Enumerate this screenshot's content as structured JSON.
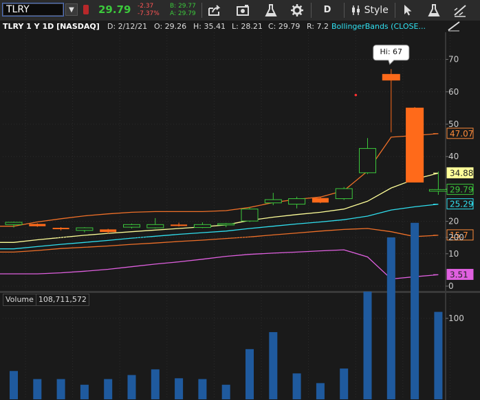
{
  "toolbar": {
    "symbol": "TLRY",
    "last_price": "29.79",
    "net_change": "-2.37",
    "pct_change": "-7.37%",
    "bid": "B: 29.77",
    "ask": "A: 29.79",
    "period_label": "D",
    "style_label": "Style"
  },
  "header": {
    "title": "TLRY 1 Y 1D [NASDAQ]",
    "date": "D: 2/12/21",
    "open": "O: 29.26",
    "high": "H: 35.41",
    "low": "L: 28.21",
    "close": "C: 29.79",
    "range": "R: 7.2",
    "study": "BollingerBands (CLOSE..."
  },
  "volume_panel": {
    "label": "Volume",
    "value": "108,711,572"
  },
  "colors": {
    "up": "#3cc93c",
    "down": "#ff6a1a",
    "upper_band": "#f07028",
    "mid_band": "#ffff99",
    "lower_band": "#f07028",
    "ma_cyan": "#30e0f0",
    "ma_magenta": "#e060e0",
    "volume": "#1f5a9e"
  },
  "chart_data": {
    "type": "candlestick",
    "price_axis": {
      "ticks": [
        0,
        10,
        20,
        30,
        40,
        50,
        60,
        70
      ],
      "range": [
        0,
        74
      ]
    },
    "volume_axis": {
      "ticks": [
        100,
        200
      ],
      "range": [
        0,
        225
      ]
    },
    "candles": [
      {
        "o": 19.0,
        "h": 19.9,
        "l": 18.1,
        "c": 19.7
      },
      {
        "o": 19.2,
        "h": 19.4,
        "l": 18.3,
        "c": 18.5
      },
      {
        "o": 18.0,
        "h": 18.2,
        "l": 17.2,
        "c": 17.6
      },
      {
        "o": 17.2,
        "h": 18.2,
        "l": 16.6,
        "c": 18.0
      },
      {
        "o": 17.5,
        "h": 17.7,
        "l": 16.2,
        "c": 16.7
      },
      {
        "o": 18.2,
        "h": 19.3,
        "l": 17.8,
        "c": 19.0
      },
      {
        "o": 18.0,
        "h": 21.0,
        "l": 17.8,
        "c": 19.0
      },
      {
        "o": 19.0,
        "h": 19.6,
        "l": 18.4,
        "c": 18.7
      },
      {
        "o": 18.1,
        "h": 19.7,
        "l": 17.9,
        "c": 19.0
      },
      {
        "o": 19.0,
        "h": 19.5,
        "l": 18.2,
        "c": 19.3
      },
      {
        "o": 20.1,
        "h": 24.3,
        "l": 19.8,
        "c": 23.8
      },
      {
        "o": 25.7,
        "h": 28.8,
        "l": 25.0,
        "c": 26.7
      },
      {
        "o": 25.3,
        "h": 27.6,
        "l": 24.0,
        "c": 27.0
      },
      {
        "o": 27.2,
        "h": 27.5,
        "l": 25.6,
        "c": 25.8
      },
      {
        "o": 27.0,
        "h": 30.6,
        "l": 26.6,
        "c": 30.1
      },
      {
        "o": 35.0,
        "h": 45.7,
        "l": 34.6,
        "c": 42.5
      },
      {
        "o": 65.5,
        "h": 67.0,
        "l": 47.5,
        "c": 63.5
      },
      {
        "o": 55.1,
        "h": 55.3,
        "l": 32.0,
        "c": 32.0
      },
      {
        "o": 29.3,
        "h": 35.4,
        "l": 28.2,
        "c": 29.8
      }
    ],
    "volumes": [
      35,
      25,
      25,
      18,
      25,
      30,
      37,
      26,
      25,
      18,
      62,
      83,
      32,
      20,
      38,
      133,
      200,
      218,
      108
    ],
    "upper_band": [
      18.5,
      19.8,
      20.8,
      21.7,
      22.3,
      22.8,
      23.0,
      23.0,
      23.0,
      23.3,
      24.3,
      25.8,
      26.8,
      27.5,
      29.5,
      35.5,
      46.0,
      46.5,
      47.07
    ],
    "mid_band": [
      13.5,
      14.3,
      15.0,
      15.7,
      16.3,
      16.8,
      17.3,
      17.8,
      18.3,
      18.9,
      20.3,
      21.3,
      22.1,
      22.8,
      23.8,
      26.2,
      30.3,
      33.0,
      34.88
    ],
    "lower_band": [
      10.5,
      11.0,
      11.6,
      12.0,
      12.4,
      12.9,
      13.3,
      13.8,
      14.2,
      14.7,
      15.2,
      15.8,
      16.4,
      17.0,
      17.5,
      17.8,
      16.8,
      15.3,
      15.7
    ],
    "cyan_line": [
      11.5,
      12.2,
      12.9,
      13.5,
      14.1,
      14.8,
      15.4,
      16.0,
      16.5,
      17.0,
      17.8,
      18.5,
      19.2,
      19.8,
      20.5,
      21.6,
      23.5,
      24.5,
      25.29
    ],
    "magenta_line": [
      3.8,
      3.8,
      4.1,
      4.6,
      5.2,
      6.0,
      6.8,
      7.5,
      8.3,
      9.2,
      9.8,
      10.2,
      10.5,
      10.9,
      11.2,
      9.0,
      2.2,
      2.9,
      3.51
    ],
    "extra_dot": {
      "index": 14.5,
      "value": 59.0
    },
    "high_label": "Hi: 67",
    "last_labels": [
      {
        "value": 47.07,
        "text": "47.07",
        "role": "upper_band"
      },
      {
        "value": 34.88,
        "text": "34.88",
        "role": "mid_band"
      },
      {
        "value": 29.79,
        "text": "29.79",
        "role": "price"
      },
      {
        "value": 25.29,
        "text": "25.29",
        "role": "cyan"
      },
      {
        "value": 15.7,
        "text": "15.7",
        "role": "lower_band"
      },
      {
        "value": 3.51,
        "text": "3.51",
        "role": "magenta"
      }
    ]
  }
}
